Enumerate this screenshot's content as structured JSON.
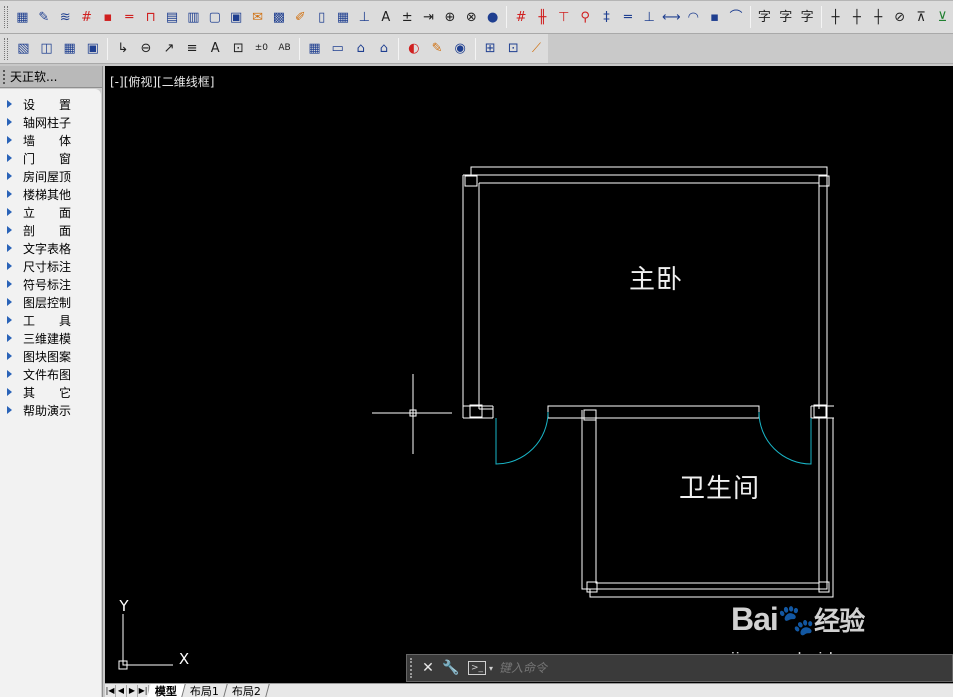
{
  "toolbar_row1": {
    "groups": [
      [
        "grid-icon",
        "edit-icon",
        "layers-icon",
        "axis-grid-icon",
        "column-icon",
        "wall-icon",
        "door-icon",
        "window-icon",
        "bay-window-icon",
        "room-icon",
        "roof-icon",
        "envelope-icon",
        "building-icon",
        "brush-icon",
        "book-icon",
        "table-icon",
        "dim-icon",
        "text-icon",
        "elevation-icon",
        "arrow-icon",
        "section-icon",
        "circle-cross-icon",
        "help-icon"
      ],
      [
        "axis-dim-icon",
        "axis-bind-icon",
        "cross-dim-icon",
        "dim-link-icon",
        "wall-dim-icon",
        "line-dim-icon",
        "door-dim-icon",
        "horizontal-dim-icon",
        "diameter-dim-icon",
        "angle-dim-icon",
        "arc-dim-icon"
      ],
      [
        "text-style-icon",
        "single-text-icon",
        "multi-text-icon"
      ],
      [
        "merge-dim-icon",
        "split-dim-icon",
        "join-dim-icon",
        "trim-dim-icon",
        "break-dim-icon",
        "extend-dim-icon"
      ]
    ]
  },
  "toolbar_row2": {
    "groups": [
      [
        "drawing-frame-icon",
        "preview-icon",
        "table-icon",
        "image-icon"
      ],
      [
        "leader-icon",
        "index-icon",
        "arrow-mark-icon",
        "multi-leader-icon",
        "elevation-mark-icon",
        "section-mark-icon",
        "level-mark-icon",
        "abc-mark-icon"
      ],
      [
        "grid-layer-icon",
        "ruler-icon",
        "slab-icon",
        "house-icon"
      ],
      [
        "eraser-icon",
        "note-icon",
        "eye-icon"
      ],
      [
        "layout-icon",
        "viewport-icon",
        "sweep-icon"
      ]
    ],
    "glyphs": {
      "level-mark-icon": "±0",
      "abc-mark-icon": "AB"
    }
  },
  "palette": {
    "title": "天正软...",
    "items": [
      "设置",
      "轴网柱子",
      "墙体",
      "门窗",
      "房间屋顶",
      "楼梯其他",
      "立面",
      "剖面",
      "文字表格",
      "尺寸标注",
      "符号标注",
      "图层控制",
      "工具",
      "三维建模",
      "图块图案",
      "文件布图",
      "其它",
      "帮助演示"
    ]
  },
  "canvas": {
    "viewport_label": "[-][俯视][二维线框]",
    "rooms": [
      {
        "name": "主卧"
      },
      {
        "name": "卫生间"
      }
    ],
    "ucs": {
      "x_label": "X",
      "y_label": "Y"
    },
    "colors": {
      "background": "#000000",
      "wall": "#ffffff",
      "door_swing": "#19b6c8",
      "text": "#f0f0f0"
    }
  },
  "command_line": {
    "placeholder": "键入命令",
    "close_glyph": "✕",
    "settings_glyph": "🔧",
    "prompt_glyph": ">_",
    "dropdown_glyph": "▾"
  },
  "watermark": {
    "logo": "Bai",
    "logo_tail": "经验",
    "url": "jingyan.baidu.com"
  },
  "layout_tabs": {
    "nav": [
      "|◀",
      "◀",
      "▶",
      "▶|"
    ],
    "tabs": [
      "模型",
      "布局1",
      "布局2"
    ],
    "active": "模型"
  }
}
